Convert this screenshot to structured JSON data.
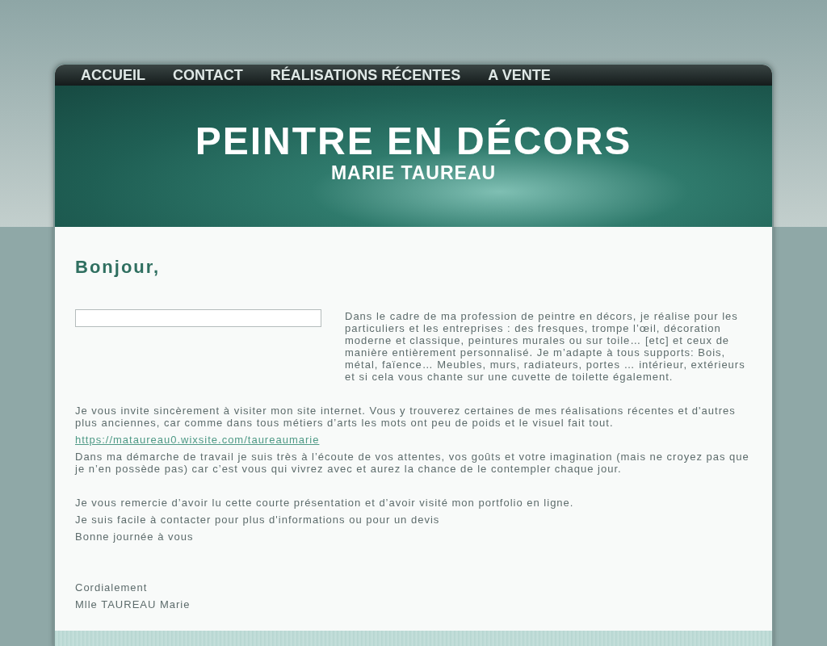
{
  "nav": [
    {
      "label": "ACCUEIL"
    },
    {
      "label": "CONTACT"
    },
    {
      "label": "RÉALISATIONS RÉCENTES"
    },
    {
      "label": "A VENTE"
    }
  ],
  "banner": {
    "title": "PEINTRE EN DÉCORS",
    "subtitle": "MARIE TAUREAU"
  },
  "heading": "Bonjour,",
  "groups": [
    [
      {
        "kind": "text",
        "text": "Dans le cadre de ma profession de peintre en décors, je réalise pour les particuliers et les entreprises : des fresques, trompe l’œil, décoration moderne et classique, peintures murales ou sur toile… [etc] et ceux de manière entièrement personnalisé. Je m’adapte à tous supports: Bois, métal, faïence… Meubles, murs, radiateurs, portes … intérieur, extérieurs et si cela vous chante sur une cuvette de toilette également."
      }
    ],
    [
      {
        "kind": "text",
        "text": "Je vous invite sincèrement à visiter mon site internet. Vous y trouverez certaines de mes réalisations récentes et d'autres plus anciennes, car comme dans tous métiers d’arts les mots ont peu de poids et le visuel fait tout."
      },
      {
        "kind": "link",
        "text": "https://mataureau0.wixsite.com/taureaumarie"
      },
      {
        "kind": "text",
        "text": "Dans ma démarche de travail je suis très à l’écoute de vos attentes, vos goûts et votre imagination (mais ne croyez pas que je n’en possède pas) car c’est vous qui vivrez avec et aurez la chance de le contempler chaque jour."
      }
    ],
    [
      {
        "kind": "text",
        "text": "Je vous remercie d’avoir lu cette courte présentation et d’avoir visité mon portfolio en ligne."
      },
      {
        "kind": "text",
        "text": "Je suis facile à contacter pour plus d'informations ou pour un devis"
      },
      {
        "kind": "text",
        "text": "Bonne journée à vous"
      }
    ],
    [
      {
        "kind": "text",
        "text": "Cordialement"
      },
      {
        "kind": "text",
        "text": "Mlle TAUREAU Marie"
      }
    ]
  ]
}
